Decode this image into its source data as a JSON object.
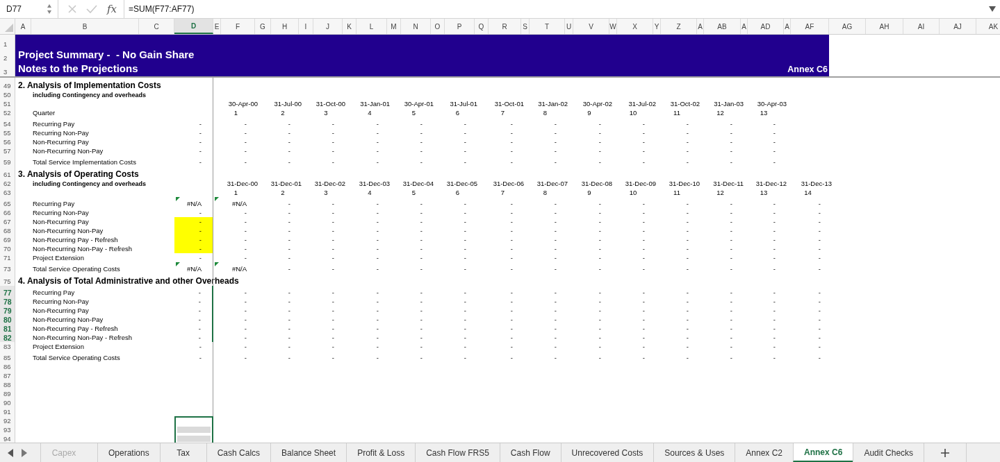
{
  "formula_bar": {
    "cell": "D77",
    "fx": "fx",
    "formula": "=SUM(F77:AF77)"
  },
  "columns": [
    {
      "label": "A",
      "selected": false
    },
    {
      "label": "B",
      "selected": false
    },
    {
      "label": "C",
      "selected": false
    },
    {
      "label": "D",
      "selected": true
    },
    {
      "label": "E",
      "selected": false
    },
    {
      "label": "F",
      "selected": false
    },
    {
      "label": "G",
      "selected": false
    },
    {
      "label": "H",
      "selected": false
    },
    {
      "label": "I",
      "selected": false
    },
    {
      "label": "J",
      "selected": false
    },
    {
      "label": "K",
      "selected": false
    },
    {
      "label": "L",
      "selected": false
    },
    {
      "label": "M",
      "selected": false
    },
    {
      "label": "N",
      "selected": false
    },
    {
      "label": "O",
      "selected": false
    },
    {
      "label": "P",
      "selected": false
    },
    {
      "label": "Q",
      "selected": false
    },
    {
      "label": "R",
      "selected": false
    },
    {
      "label": "S",
      "selected": false
    },
    {
      "label": "T",
      "selected": false
    },
    {
      "label": "U",
      "selected": false
    },
    {
      "label": "V",
      "selected": false
    },
    {
      "label": "W",
      "selected": false
    },
    {
      "label": "X",
      "selected": false
    },
    {
      "label": "Y",
      "selected": false
    },
    {
      "label": "Z",
      "selected": false
    },
    {
      "label": "A",
      "selected": false
    },
    {
      "label": "AB",
      "selected": false
    },
    {
      "label": "A",
      "selected": false
    },
    {
      "label": "AD",
      "selected": false
    },
    {
      "label": "A",
      "selected": false
    },
    {
      "label": "AF",
      "selected": false
    },
    {
      "label": "AG",
      "selected": false
    },
    {
      "label": "AH",
      "selected": false
    },
    {
      "label": "AI",
      "selected": false
    },
    {
      "label": "AJ",
      "selected": false
    },
    {
      "label": "AK",
      "selected": false
    }
  ],
  "banner": {
    "row_numbers": [
      "1",
      "2",
      "3"
    ],
    "title": "Project Summary -  - No Gain Share",
    "subtitle": "Notes to the Projections",
    "annex": "Annex C6"
  },
  "rows": [
    {
      "num": "49",
      "kind": "heading",
      "label": "2. Analysis of Implementation Costs",
      "selected": false,
      "highlighted": false,
      "boxed": false
    },
    {
      "num": "50",
      "kind": "note",
      "label": "including Contingency and overheads",
      "selected": false,
      "highlighted": false,
      "boxed": false
    },
    {
      "num": "51",
      "kind": "dates",
      "selected": false,
      "highlighted": false,
      "boxed": false,
      "values": [
        "30-Apr-00",
        "31-Jul-00",
        "31-Oct-00",
        "31-Jan-01",
        "30-Apr-01",
        "31-Jul-01",
        "31-Oct-01",
        "31-Jan-02",
        "30-Apr-02",
        "31-Jul-02",
        "31-Oct-02",
        "31-Jan-03",
        "30-Apr-03"
      ]
    },
    {
      "num": "52",
      "kind": "index",
      "label": "Quarter",
      "selected": false,
      "highlighted": false,
      "boxed": false,
      "values": [
        "1",
        "2",
        "3",
        "4",
        "5",
        "6",
        "7",
        "8",
        "9",
        "10",
        "11",
        "12",
        "13"
      ]
    },
    {
      "num": "54",
      "kind": "line",
      "label": "Recurring Pay",
      "d": "-",
      "flagged": false,
      "selected": false,
      "highlighted": false,
      "boxed": false,
      "values": [
        "-",
        "-",
        "-",
        "-",
        "-",
        "-",
        "-",
        "-",
        "-",
        "-",
        "-",
        "-",
        "-"
      ]
    },
    {
      "num": "55",
      "kind": "line",
      "label": "Recurring Non-Pay",
      "d": "-",
      "flagged": false,
      "selected": false,
      "highlighted": false,
      "boxed": false,
      "values": [
        "-",
        "-",
        "-",
        "-",
        "-",
        "-",
        "-",
        "-",
        "-",
        "-",
        "-",
        "-",
        "-"
      ]
    },
    {
      "num": "56",
      "kind": "line",
      "label": "Non-Recurring Pay",
      "d": "-",
      "flagged": false,
      "selected": false,
      "highlighted": false,
      "boxed": false,
      "values": [
        "-",
        "-",
        "-",
        "-",
        "-",
        "-",
        "-",
        "-",
        "-",
        "-",
        "-",
        "-",
        "-"
      ]
    },
    {
      "num": "57",
      "kind": "line",
      "label": "Non-Recurring Non-Pay",
      "d": "-",
      "flagged": false,
      "selected": false,
      "highlighted": false,
      "boxed": false,
      "values": [
        "-",
        "-",
        "-",
        "-",
        "-",
        "-",
        "-",
        "-",
        "-",
        "-",
        "-",
        "-",
        "-"
      ]
    },
    {
      "num": "59",
      "kind": "line",
      "label": "Total Service Implementation Costs",
      "d": "-",
      "flagged": false,
      "selected": false,
      "highlighted": false,
      "boxed": false,
      "values": [
        "-",
        "-",
        "-",
        "-",
        "-",
        "-",
        "-",
        "-",
        "-",
        "-",
        "-",
        "-",
        "-"
      ]
    },
    {
      "num": "61",
      "kind": "heading",
      "label": "3. Analysis of Operating Costs",
      "selected": false,
      "highlighted": false,
      "boxed": false
    },
    {
      "num": "62",
      "kind": "dates",
      "label": "including Contingency and overheads",
      "selected": false,
      "highlighted": false,
      "boxed": false,
      "values": [
        "31-Dec-00",
        "31-Dec-01",
        "31-Dec-02",
        "31-Dec-03",
        "31-Dec-04",
        "31-Dec-05",
        "31-Dec-06",
        "31-Dec-07",
        "31-Dec-08",
        "31-Dec-09",
        "31-Dec-10",
        "31-Dec-11",
        "31-Dec-12",
        "31-Dec-13"
      ]
    },
    {
      "num": "63",
      "kind": "index",
      "selected": false,
      "highlighted": false,
      "boxed": false,
      "values": [
        "1",
        "2",
        "3",
        "4",
        "5",
        "6",
        "7",
        "8",
        "9",
        "10",
        "11",
        "12",
        "13",
        "14"
      ]
    },
    {
      "num": "65",
      "kind": "line",
      "label": "Recurring Pay",
      "d": "#N/A",
      "flagged": true,
      "selected": false,
      "highlighted": false,
      "boxed": false,
      "values": [
        "#N/A",
        "-",
        "-",
        "-",
        "-",
        "-",
        "-",
        "-",
        "-",
        "-",
        "-",
        "-",
        "-",
        "-"
      ]
    },
    {
      "num": "66",
      "kind": "line",
      "label": "Recurring Non-Pay",
      "d": "-",
      "flagged": false,
      "selected": false,
      "highlighted": false,
      "boxed": false,
      "values": [
        "-",
        "-",
        "-",
        "-",
        "-",
        "-",
        "-",
        "-",
        "-",
        "-",
        "-",
        "-",
        "-",
        "-"
      ]
    },
    {
      "num": "67",
      "kind": "line",
      "label": "Non-Recurring Pay",
      "d": "-",
      "flagged": false,
      "selected": false,
      "highlighted": true,
      "boxed": false,
      "values": [
        "-",
        "-",
        "-",
        "-",
        "-",
        "-",
        "-",
        "-",
        "-",
        "-",
        "-",
        "-",
        "-",
        "-"
      ]
    },
    {
      "num": "68",
      "kind": "line",
      "label": "Non-Recurring Non-Pay",
      "d": "-",
      "flagged": false,
      "selected": false,
      "highlighted": true,
      "boxed": false,
      "values": [
        "-",
        "-",
        "-",
        "-",
        "-",
        "-",
        "-",
        "-",
        "-",
        "-",
        "-",
        "-",
        "-",
        "-"
      ]
    },
    {
      "num": "69",
      "kind": "line",
      "label": "Non-Recurring Pay - Refresh",
      "d": "-",
      "flagged": false,
      "selected": false,
      "highlighted": true,
      "boxed": false,
      "values": [
        "-",
        "-",
        "-",
        "-",
        "-",
        "-",
        "-",
        "-",
        "-",
        "-",
        "-",
        "-",
        "-",
        "-"
      ]
    },
    {
      "num": "70",
      "kind": "line",
      "label": "Non-Recurring Non-Pay - Refresh",
      "d": "-",
      "flagged": false,
      "selected": false,
      "highlighted": true,
      "boxed": false,
      "values": [
        "-",
        "-",
        "-",
        "-",
        "-",
        "-",
        "-",
        "-",
        "-",
        "-",
        "-",
        "-",
        "-",
        "-"
      ]
    },
    {
      "num": "71",
      "kind": "line",
      "label": "Project Extension",
      "d": "-",
      "flagged": false,
      "selected": false,
      "highlighted": false,
      "boxed": false,
      "values": [
        "-",
        "-",
        "-",
        "-",
        "-",
        "-",
        "-",
        "-",
        "-",
        "-",
        "-",
        "-",
        "-",
        "-"
      ]
    },
    {
      "num": "73",
      "kind": "line",
      "label": "Total Service Operating Costs",
      "d": "#N/A",
      "flagged": true,
      "selected": false,
      "highlighted": false,
      "boxed": false,
      "values": [
        "#N/A",
        "-",
        "-",
        "-",
        "-",
        "-",
        "-",
        "-",
        "-",
        "-",
        "-",
        "-",
        "-",
        "-"
      ]
    },
    {
      "num": "75",
      "kind": "heading",
      "label": "4. Analysis of Total Administrative and other Overheads",
      "selected": false,
      "highlighted": false,
      "boxed": false
    },
    {
      "num": "77",
      "kind": "line",
      "label": "Recurring Pay",
      "d": "-",
      "flagged": false,
      "selected": true,
      "highlighted": false,
      "boxed": false,
      "values": [
        "-",
        "-",
        "-",
        "-",
        "-",
        "-",
        "-",
        "-",
        "-",
        "-",
        "-",
        "-",
        "-",
        "-"
      ]
    },
    {
      "num": "78",
      "kind": "line",
      "label": "Recurring Non-Pay",
      "d": "-",
      "flagged": false,
      "selected": true,
      "highlighted": false,
      "boxed": false,
      "values": [
        "-",
        "-",
        "-",
        "-",
        "-",
        "-",
        "-",
        "-",
        "-",
        "-",
        "-",
        "-",
        "-",
        "-"
      ]
    },
    {
      "num": "79",
      "kind": "line",
      "label": "Non-Recurring Pay",
      "d": "-",
      "flagged": false,
      "selected": true,
      "highlighted": false,
      "boxed": false,
      "values": [
        "-",
        "-",
        "-",
        "-",
        "-",
        "-",
        "-",
        "-",
        "-",
        "-",
        "-",
        "-",
        "-",
        "-"
      ]
    },
    {
      "num": "80",
      "kind": "line",
      "label": "Non-Recurring Non-Pay",
      "d": "-",
      "flagged": false,
      "selected": true,
      "highlighted": false,
      "boxed": false,
      "values": [
        "-",
        "-",
        "-",
        "-",
        "-",
        "-",
        "-",
        "-",
        "-",
        "-",
        "-",
        "-",
        "-",
        "-"
      ]
    },
    {
      "num": "81",
      "kind": "line",
      "label": "Non-Recurring Pay - Refresh",
      "d": "-",
      "flagged": false,
      "selected": true,
      "highlighted": false,
      "boxed": false,
      "values": [
        "-",
        "-",
        "-",
        "-",
        "-",
        "-",
        "-",
        "-",
        "-",
        "-",
        "-",
        "-",
        "-",
        "-"
      ]
    },
    {
      "num": "82",
      "kind": "line",
      "label": "Non-Recurring Non-Pay - Refresh",
      "d": "-",
      "flagged": false,
      "selected": true,
      "highlighted": false,
      "boxed": false,
      "values": [
        "-",
        "-",
        "-",
        "-",
        "-",
        "-",
        "-",
        "-",
        "-",
        "-",
        "-",
        "-",
        "-",
        "-"
      ]
    },
    {
      "num": "83",
      "kind": "line",
      "label": "Project Extension",
      "d": "-",
      "flagged": false,
      "selected": false,
      "highlighted": false,
      "boxed": false,
      "values": [
        "-",
        "-",
        "-",
        "-",
        "-",
        "-",
        "-",
        "-",
        "-",
        "-",
        "-",
        "-",
        "-",
        "-"
      ]
    },
    {
      "num": "85",
      "kind": "line",
      "label": "Total Service Operating Costs",
      "d": "-",
      "flagged": false,
      "selected": false,
      "highlighted": false,
      "boxed": false,
      "values": [
        "-",
        "-",
        "-",
        "-",
        "-",
        "-",
        "-",
        "-",
        "-",
        "-",
        "-",
        "-",
        "-",
        "-"
      ]
    },
    {
      "num": "86",
      "kind": "blank",
      "selected": false,
      "highlighted": false,
      "boxed": false
    },
    {
      "num": "87",
      "kind": "blank",
      "selected": false,
      "highlighted": false,
      "boxed": false
    },
    {
      "num": "88",
      "kind": "blank",
      "selected": false,
      "highlighted": false,
      "boxed": false
    },
    {
      "num": "89",
      "kind": "blank",
      "selected": false,
      "highlighted": false,
      "boxed": false
    },
    {
      "num": "90",
      "kind": "blank",
      "selected": false,
      "highlighted": false,
      "boxed": false
    },
    {
      "num": "91",
      "kind": "blank",
      "selected": false,
      "highlighted": false,
      "boxed": false
    },
    {
      "num": "92",
      "kind": "blank",
      "selected": false,
      "highlighted": false,
      "boxed": true
    },
    {
      "num": "93",
      "kind": "blank",
      "selected": false,
      "highlighted": false,
      "boxed": true
    },
    {
      "num": "94",
      "kind": "blank",
      "selected": false,
      "highlighted": false,
      "boxed": true
    }
  ],
  "tabs": [
    {
      "label": "Capex",
      "selected": false,
      "faded": true
    },
    {
      "label": "Operations",
      "selected": false,
      "faded": false
    },
    {
      "label": "Tax",
      "selected": false,
      "faded": false
    },
    {
      "label": "Cash Calcs",
      "selected": false,
      "faded": false
    },
    {
      "label": "Balance Sheet",
      "selected": false,
      "faded": false
    },
    {
      "label": "Profit & Loss",
      "selected": false,
      "faded": false
    },
    {
      "label": "Cash Flow FRS5",
      "selected": false,
      "faded": false
    },
    {
      "label": "Cash Flow",
      "selected": false,
      "faded": false
    },
    {
      "label": "Unrecovered Costs",
      "selected": false,
      "faded": false
    },
    {
      "label": "Sources & Uses",
      "selected": false,
      "faded": false
    },
    {
      "label": "Annex C2",
      "selected": false,
      "faded": false
    },
    {
      "label": "Annex C6",
      "selected": true,
      "faded": false
    },
    {
      "label": "Audit Checks",
      "selected": false,
      "faded": false
    }
  ]
}
